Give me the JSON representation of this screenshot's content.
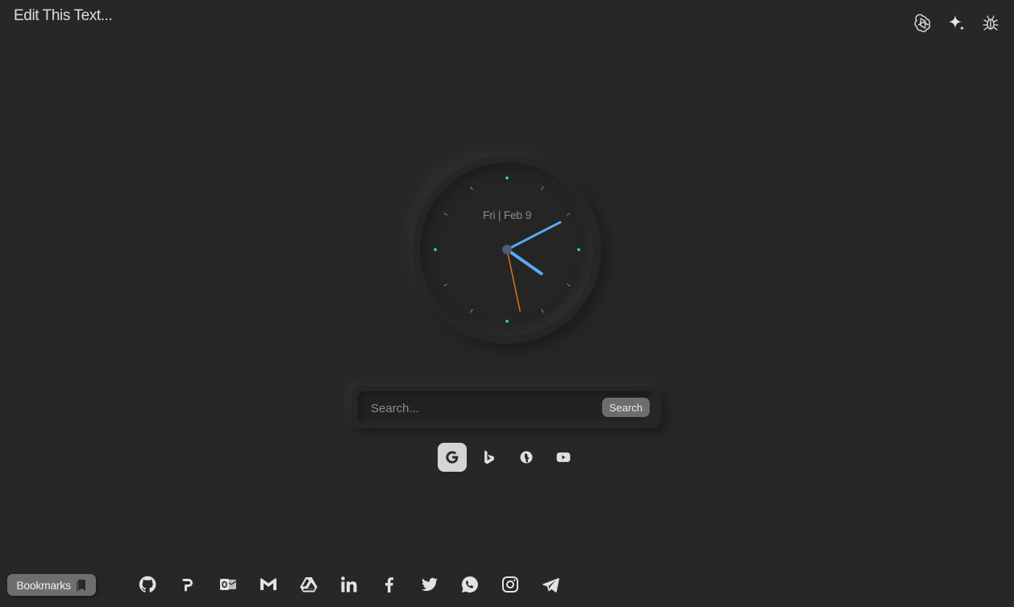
{
  "user_text": "Edit This Text...",
  "top_icons": [
    "chatgpt-icon",
    "gemini-sparkle-icon",
    "bug-icon"
  ],
  "clock": {
    "date": "Fri | Feb 9",
    "time": {
      "hour": 4,
      "minute": 10,
      "second": 28
    }
  },
  "search": {
    "placeholder": "Search...",
    "button_label": "Search"
  },
  "search_engines": [
    {
      "name": "google-icon",
      "active": true
    },
    {
      "name": "bing-icon",
      "active": false
    },
    {
      "name": "duckduckgo-icon",
      "active": false
    },
    {
      "name": "youtube-icon",
      "active": false
    }
  ],
  "bookmarks": {
    "label": "Bookmarks",
    "icon": "bookmark-icon"
  },
  "shortcuts": [
    "github-icon",
    "producthunt-icon",
    "outlook-icon",
    "gmail-icon",
    "google-drive-icon",
    "linkedin-icon",
    "facebook-icon",
    "twitter-icon",
    "whatsapp-icon",
    "instagram-icon",
    "telegram-icon"
  ],
  "colors": {
    "background": "#272727",
    "hour_minute_hand": "#5aa9f0",
    "second_hand": "#e07b1a",
    "hour_markers": "#3fd6e0",
    "icon": "#dedede"
  }
}
